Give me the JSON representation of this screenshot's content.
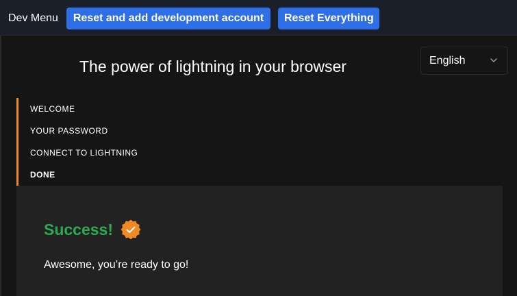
{
  "dev_menu": {
    "title": "Dev Menu",
    "reset_dev_label": "Reset and add development account",
    "reset_all_label": "Reset Everything"
  },
  "hero": {
    "title": "The power of lightning in your browser"
  },
  "language_select": {
    "selected": "English"
  },
  "steps": [
    {
      "label": "WELCOME",
      "active": false
    },
    {
      "label": "YOUR PASSWORD",
      "active": false
    },
    {
      "label": "CONNECT TO LIGHTNING",
      "active": false
    },
    {
      "label": "DONE",
      "active": true
    }
  ],
  "card": {
    "title": "Success!",
    "message": "Awesome, you’re ready to go!",
    "badge_icon": "check-badge-icon"
  },
  "colors": {
    "accent_blue": "#2f6fe5",
    "accent_orange": "#f08a24",
    "success_green": "#2eaa52"
  }
}
